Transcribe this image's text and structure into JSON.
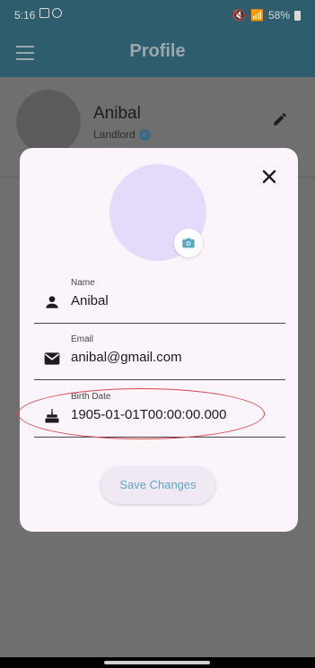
{
  "status_bar": {
    "time": "5:16",
    "battery_text": "58%"
  },
  "app_bar": {
    "title": "Profile"
  },
  "background_profile": {
    "name": "Anibal",
    "role": "Landlord"
  },
  "dialog": {
    "fields": [
      {
        "label": "Name",
        "value": "Anibal",
        "icon": "person-icon"
      },
      {
        "label": "Email",
        "value": "anibal@gmail.com",
        "icon": "mail-icon"
      },
      {
        "label": "Birth Date",
        "value": "1905-01-01T00:00:00.000",
        "icon": "cake-icon"
      }
    ],
    "save_label": "Save Changes"
  },
  "colors": {
    "app_bar": "#2e5d6e",
    "dialog_bg": "#fbf4fb",
    "avatar_bg": "#e4dbfb",
    "accent": "#5aa8c8",
    "annotation": "#d9484f"
  }
}
